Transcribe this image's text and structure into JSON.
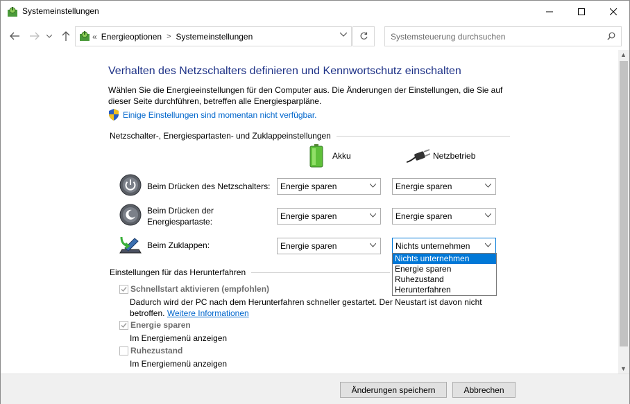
{
  "window": {
    "title": "Systemeinstellungen"
  },
  "nav": {
    "breadcrumb_prefix": "«",
    "breadcrumbs": [
      "Energieoptionen",
      "Systemeinstellungen"
    ],
    "search_placeholder": "Systemsteuerung durchsuchen"
  },
  "main": {
    "heading": "Verhalten des Netzschalters definieren und Kennwortschutz einschalten",
    "description": "Wählen Sie die Energieeinstellungen für den Computer aus. Die Änderungen der Einstellungen, die Sie auf dieser Seite durchführen, betreffen alle Energiesparpläne.",
    "unavailable_link": "Einige Einstellungen sind momentan nicht verfügbar.",
    "section_buttons": "Netzschalter-, Energiespartasten- und Zuklappeinstellungen",
    "col_battery": "Akku",
    "col_power": "Netzbetrieb",
    "rows": [
      {
        "label": "Beim Drücken des Netzschalters:",
        "battery": "Energie sparen",
        "power": "Energie sparen"
      },
      {
        "label": "Beim Drücken der Energiespartaste:",
        "battery": "Energie sparen",
        "power": "Energie sparen"
      },
      {
        "label": "Beim Zuklappen:",
        "battery": "Energie sparen",
        "power": "Nichts unternehmen"
      }
    ],
    "dropdown_options": [
      "Nichts unternehmen",
      "Energie sparen",
      "Ruhezustand",
      "Herunterfahren"
    ],
    "section_shutdown": "Einstellungen für das Herunterfahren",
    "shutdown": [
      {
        "label": "Schnellstart aktivieren (empfohlen)",
        "checked": true,
        "desc": "Dadurch wird der PC nach dem Herunterfahren schneller gestartet. Der Neustart ist davon nicht betroffen.",
        "link": "Weitere Informationen"
      },
      {
        "label": "Energie sparen",
        "checked": true,
        "desc": "Im Energiemenü anzeigen"
      },
      {
        "label": "Ruhezustand",
        "checked": false,
        "desc": "Im Energiemenü anzeigen"
      }
    ]
  },
  "footer": {
    "save": "Änderungen speichern",
    "cancel": "Abbrechen"
  },
  "colors": {
    "heading": "#1e3287",
    "link": "#0066cc",
    "selection": "#0078d7"
  },
  "icons": [
    "app-icon",
    "back-arrow-icon",
    "forward-arrow-icon",
    "recent-chevron-icon",
    "up-arrow-icon",
    "chevron-down-icon",
    "refresh-icon",
    "search-icon",
    "shield-icon",
    "battery-icon",
    "power-plug-icon",
    "power-button-icon",
    "sleep-button-icon",
    "laptop-lid-icon"
  ]
}
